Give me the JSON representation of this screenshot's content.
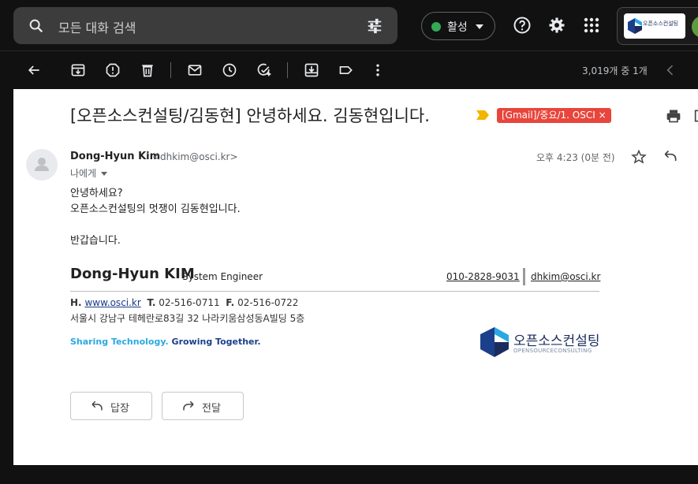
{
  "search": {
    "placeholder": "모든 대화 검색"
  },
  "status": {
    "label": "활성",
    "color": "#34a853"
  },
  "brand": {
    "logo_text": "오픈소스컨설팅"
  },
  "toolbar": {
    "count": "3,019개 중 1개"
  },
  "email": {
    "subject": "[오픈소스컨설팅/김동현] 안녕하세요. 김동현입니다.",
    "label": "[Gmail]/중요/1. OSCI",
    "label_close": "×",
    "sender_name": "Dong-Hyun Kim",
    "sender_email": "<dhkim@osci.kr>",
    "to": "나에게",
    "time": "오후 4:23 (0분 전)",
    "body_lines": [
      "안녕하세요?",
      "오픈소스컨설팅의 멋쟁이 김동현입니다.",
      "",
      "반갑습니다."
    ]
  },
  "signature": {
    "name": "Dong-Hyun KIM",
    "title": "System Engineer",
    "phone": "010-2828-9031",
    "email": "dhkim@osci.kr",
    "h_label": "H.",
    "website": "www.osci.kr",
    "t_label": "T.",
    "tel": "02-516-0711",
    "f_label": "F.",
    "fax": "02-516-0722",
    "address": "서울시 강남구 테헤란로83길 32 나라키움삼성동A빌딩 5층",
    "slogan_1": "Sharing Technology.",
    "slogan_2": "Growing Together.",
    "company_kr": "오픈소스컨설팅",
    "company_en": "OPENSOURCECONSULTING"
  },
  "actions": {
    "reply": "답장",
    "forward": "전달"
  },
  "colors": {
    "label_red": "#e8453c",
    "important": "#f4b400",
    "brand_navy": "#1b2c5c",
    "brand_blue": "#29a9e1"
  }
}
